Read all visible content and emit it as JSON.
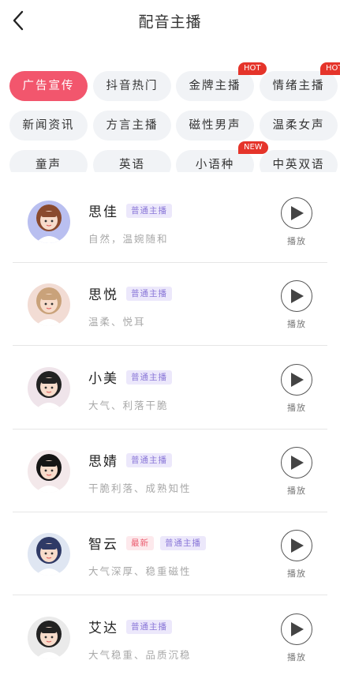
{
  "header": {
    "title": "配音主播",
    "back_icon": "chevron-left-icon"
  },
  "categories": [
    {
      "label": "广告宣传",
      "active": true
    },
    {
      "label": "抖音热门"
    },
    {
      "label": "金牌主播",
      "badge": "HOT"
    },
    {
      "label": "情绪主播",
      "badge": "HOT"
    },
    {
      "label": "新闻资讯"
    },
    {
      "label": "方言主播"
    },
    {
      "label": "磁性男声"
    },
    {
      "label": "温柔女声"
    },
    {
      "label": "童声"
    },
    {
      "label": "英语"
    },
    {
      "label": "小语种",
      "badge": "NEW"
    },
    {
      "label": "中英双语"
    }
  ],
  "anchors": [
    {
      "name": "思佳",
      "tags": [
        {
          "text": "普通主播",
          "kind": "normal"
        }
      ],
      "desc": "自然，温婉随和",
      "play_label": "播放",
      "avatar_color": "#b9bff0"
    },
    {
      "name": "思悦",
      "tags": [
        {
          "text": "普通主播",
          "kind": "normal"
        }
      ],
      "desc": "温柔、悦耳",
      "play_label": "播放",
      "avatar_color": "#f2dcd4"
    },
    {
      "name": "小美",
      "tags": [
        {
          "text": "普通主播",
          "kind": "normal"
        }
      ],
      "desc": "大气、利落干脆",
      "play_label": "播放",
      "avatar_color": "#efe4ea"
    },
    {
      "name": "思婧",
      "tags": [
        {
          "text": "普通主播",
          "kind": "normal"
        }
      ],
      "desc": "干脆利落、成熟知性",
      "play_label": "播放",
      "avatar_color": "#f3e8ea"
    },
    {
      "name": "智云",
      "tags": [
        {
          "text": "最新",
          "kind": "new"
        },
        {
          "text": "普通主播",
          "kind": "normal"
        }
      ],
      "desc": "大气深厚、稳重磁性",
      "play_label": "播放",
      "avatar_color": "#dfe6f2"
    },
    {
      "name": "艾达",
      "tags": [
        {
          "text": "普通主播",
          "kind": "normal"
        }
      ],
      "desc": "大气稳重、品质沉稳",
      "play_label": "播放",
      "avatar_color": "#eaeaea"
    }
  ],
  "colors": {
    "accent": "#f2566d",
    "badge": "#e5342a",
    "tag_normal": "#8b78d8",
    "tag_new": "#ea5b6e"
  },
  "icons": {
    "play": "play-icon"
  }
}
